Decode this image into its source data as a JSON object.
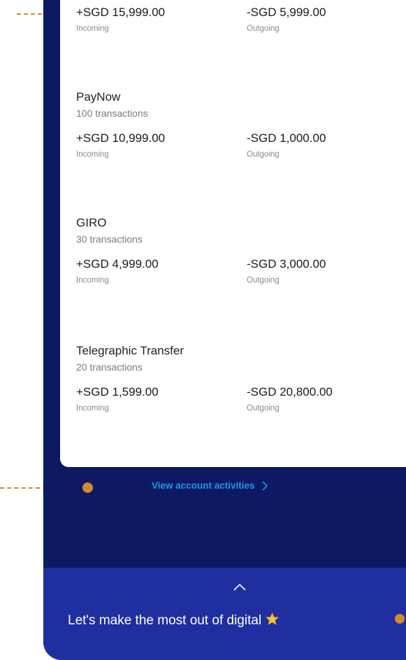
{
  "top_row": {
    "incoming_amount": "+SGD 15,999.00",
    "incoming_label": "Incoming",
    "outgoing_amount": "-SGD 5,999.00",
    "outgoing_label": "Outgoing"
  },
  "groups": [
    {
      "name": "PayNow",
      "count": "100 transactions",
      "incoming_amount": "+SGD 10,999.00",
      "incoming_label": "Incoming",
      "outgoing_amount": "-SGD 1,000.00",
      "outgoing_label": "Outgoing"
    },
    {
      "name": "GIRO",
      "count": "30 transactions",
      "incoming_amount": "+SGD 4,999.00",
      "incoming_label": "Incoming",
      "outgoing_amount": "-SGD 3,000.00",
      "outgoing_label": "Outgoing"
    },
    {
      "name": "Telegraphic Transfer",
      "count": "20 transactions",
      "incoming_amount": "+SGD 1,599.00",
      "incoming_label": "Incoming",
      "outgoing_amount": "-SGD 20,800.00",
      "outgoing_label": "Outgoing"
    }
  ],
  "activities_link": {
    "label": "View account activities",
    "icon": "chevron-right-icon"
  },
  "banner": {
    "text": "Let's make the most out of digital",
    "expand_icon": "chevron-up-icon",
    "star_icon": "star-icon"
  },
  "colors": {
    "background": "#0d1a63",
    "card": "#ffffff",
    "banner": "#1f2fa0",
    "link": "#1e98e6",
    "annotation": "#d18a2c",
    "star": "#f2c33a"
  }
}
